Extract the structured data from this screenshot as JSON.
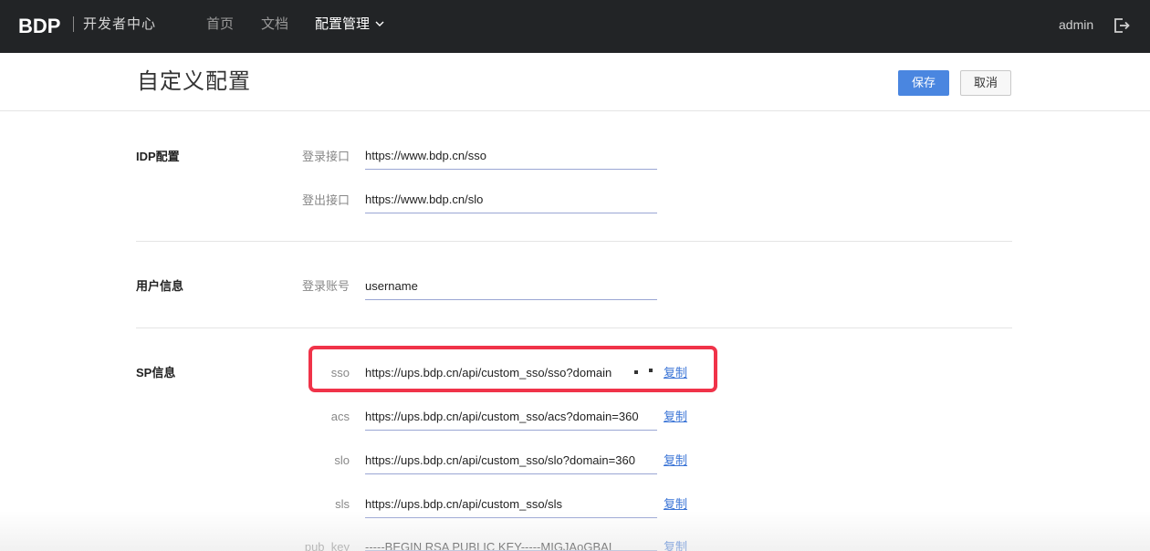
{
  "topbar": {
    "logo_text": "BDP",
    "subtitle": "开发者中心",
    "nav": [
      {
        "label": "首页"
      },
      {
        "label": "文档"
      },
      {
        "label": "配置管理"
      }
    ],
    "user": "admin",
    "logout_icon": "logout-icon"
  },
  "page": {
    "title": "自定义配置",
    "save_label": "保存",
    "cancel_label": "取消"
  },
  "idp": {
    "title": "IDP配置",
    "login_label": "登录接口",
    "login_value": "https://www.bdp.cn/sso",
    "logout_label": "登出接口",
    "logout_value": "https://www.bdp.cn/slo"
  },
  "user_info": {
    "title": "用户信息",
    "account_label": "登录账号",
    "account_value": "username"
  },
  "sp": {
    "title": "SP信息",
    "copy_label": "复制",
    "fields": [
      {
        "label": "sso",
        "value": "https://ups.bdp.cn/api/custom_sso/sso?domain"
      },
      {
        "label": "acs",
        "value": "https://ups.bdp.cn/api/custom_sso/acs?domain=360"
      },
      {
        "label": "slo",
        "value": "https://ups.bdp.cn/api/custom_sso/slo?domain=360"
      },
      {
        "label": "sls",
        "value": "https://ups.bdp.cn/api/custom_sso/sls"
      },
      {
        "label": "pub_key",
        "value": "-----BEGIN RSA PUBLIC KEY-----MIGJAoGBAI"
      }
    ]
  },
  "colors": {
    "topbar_bg": "#222426",
    "primary": "#4a86e0",
    "link": "#3a74d6",
    "highlight": "#f03349"
  }
}
